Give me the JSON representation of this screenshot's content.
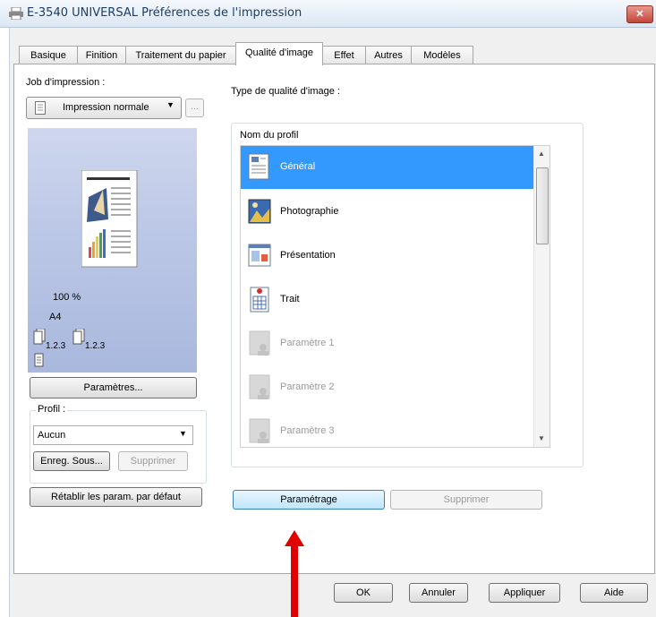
{
  "window": {
    "title": "E-3540 UNIVERSAL Préférences de l'impression",
    "close_glyph": "✕"
  },
  "tabs": [
    {
      "label": "Basique",
      "active": false
    },
    {
      "label": "Finition",
      "active": false
    },
    {
      "label": "Traitement du papier",
      "active": false
    },
    {
      "label": "Qualité d'image",
      "active": true
    },
    {
      "label": "Effet",
      "active": false
    },
    {
      "label": "Autres",
      "active": false
    },
    {
      "label": "Modèles",
      "active": false
    }
  ],
  "left_panel": {
    "job_label": "Job d'impression :",
    "job_value": "Impression normale",
    "job_more": "...",
    "preview": {
      "zoom": "100 %",
      "paper": "A4",
      "collate1": "1.2.3",
      "collate2": "1.2.3"
    },
    "params_button": "Paramètres...",
    "profile_group": "Profil :",
    "profile_value": "Aucun",
    "save_as_button": "Enreg. Sous...",
    "delete_button": "Supprimer",
    "restore_button": "Rétablir les param. par défaut"
  },
  "main": {
    "type_label": "Type de qualité d'image :",
    "list_header": "Nom du profil",
    "profiles": [
      {
        "label": "Général",
        "icon": "general-profile-icon",
        "selected": true,
        "enabled": true
      },
      {
        "label": "Photographie",
        "icon": "photo-profile-icon",
        "selected": false,
        "enabled": true
      },
      {
        "label": "Présentation",
        "icon": "presentation-profile-icon",
        "selected": false,
        "enabled": true
      },
      {
        "label": "Trait",
        "icon": "line-profile-icon",
        "selected": false,
        "enabled": true
      },
      {
        "label": "Paramètre 1",
        "icon": "user-profile-icon",
        "selected": false,
        "enabled": false
      },
      {
        "label": "Paramètre 2",
        "icon": "user-profile-icon",
        "selected": false,
        "enabled": false
      },
      {
        "label": "Paramètre 3",
        "icon": "user-profile-icon",
        "selected": false,
        "enabled": false
      }
    ],
    "setup_button": "Paramétrage",
    "delete_button": "Supprimer"
  },
  "footer": {
    "ok": "OK",
    "cancel": "Annuler",
    "apply": "Appliquer",
    "help": "Aide"
  },
  "colors": {
    "selection": "#3399ff",
    "annotation_arrow": "#e00000"
  }
}
